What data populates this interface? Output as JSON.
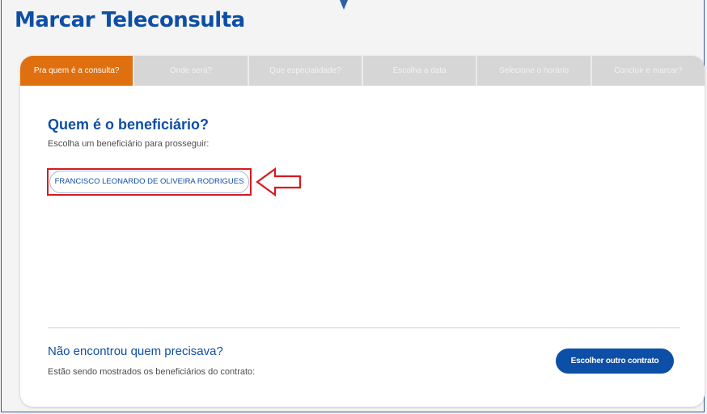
{
  "page": {
    "title": "Marcar Teleconsulta"
  },
  "steps": [
    {
      "label": "Pra quem é a consulta?",
      "active": true
    },
    {
      "label": "Onde será?",
      "active": false
    },
    {
      "label": "Que especialidade?",
      "active": false
    },
    {
      "label": "Escolha a data",
      "active": false
    },
    {
      "label": "Selecione o horário",
      "active": false
    },
    {
      "label": "Concluir e marcar?",
      "active": false
    }
  ],
  "beneficiary_section": {
    "heading": "Quem é o beneficiário?",
    "subtitle": "Escolha um beneficiário para prosseguir:",
    "beneficiaries": [
      "FRANCISCO LEONARDO DE OLIVEIRA RODRIGUES"
    ]
  },
  "footer": {
    "title": "Não encontrou quem precisava?",
    "text": "Estão sendo mostrados os beneficiários do contrato:",
    "button_label": "Escolher outro contrato"
  },
  "colors": {
    "brand_blue": "#0d4ea6",
    "active_step": "#e0700f",
    "inactive_step": "#d6d6d6",
    "annotation_red": "#d71920"
  }
}
